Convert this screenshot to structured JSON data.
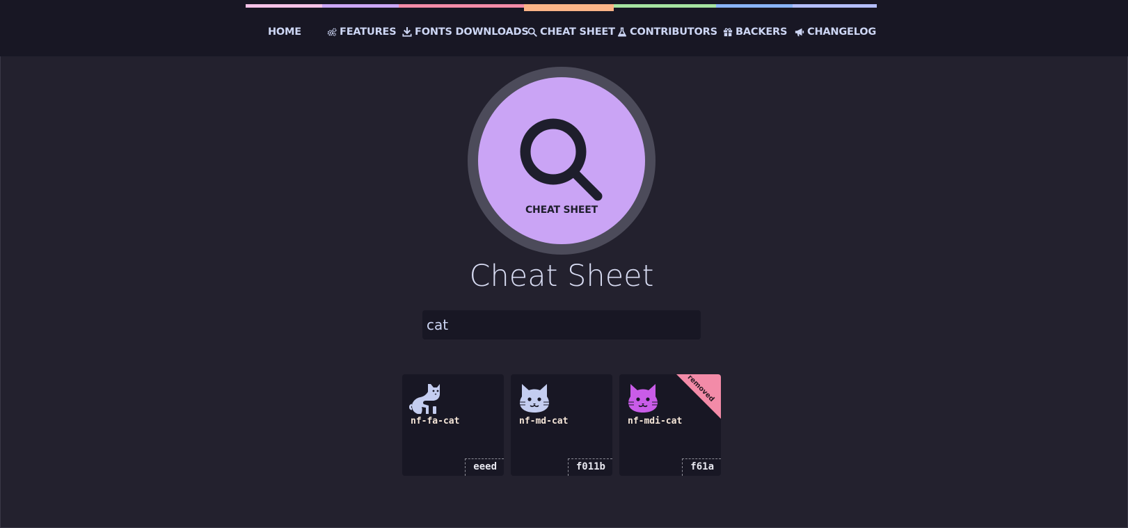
{
  "colors": {
    "background": "#23212e",
    "header_bg": "#181724",
    "accent_lavender": "#caa4f5",
    "text": "#cdd6f4",
    "removed_ribbon": "#f38ba8",
    "rainbow": [
      "#f5c2e7",
      "#cba6f7",
      "#f38ba8",
      "#fab387",
      "#a6e3a1",
      "#89b4fa",
      "#b4befe"
    ]
  },
  "nav": {
    "items": [
      {
        "label": "HOME",
        "icon": ""
      },
      {
        "label": "FEATURES",
        "icon": "cogs-icon"
      },
      {
        "label": "FONTS DOWNLOADS",
        "icon": "download-icon"
      },
      {
        "label": "CHEAT SHEET",
        "icon": "search-icon"
      },
      {
        "label": "CONTRIBUTORS",
        "icon": "flask-icon"
      },
      {
        "label": "BACKERS",
        "icon": "gift-icon"
      },
      {
        "label": "CHANGELOG",
        "icon": "bullhorn-icon"
      }
    ],
    "active": "CHEAT SHEET"
  },
  "hero": {
    "icon": "search-icon",
    "caption": "CHEAT SHEET"
  },
  "page": {
    "title": "Cheat Sheet"
  },
  "search": {
    "value": "cat",
    "placeholder": ""
  },
  "results": [
    {
      "name": "nf-fa-cat",
      "code": "eeed",
      "icon": "cat-sitting-icon",
      "color": "#c4cdf0",
      "removed": false
    },
    {
      "name": "nf-md-cat",
      "code": "f011b",
      "icon": "cat-face-icon",
      "color": "#c4cdf0",
      "removed": false
    },
    {
      "name": "nf-mdi-cat",
      "code": "f61a",
      "icon": "cat-face-icon",
      "color": "#c95ce8",
      "removed": true,
      "ribbon": "removed"
    }
  ]
}
